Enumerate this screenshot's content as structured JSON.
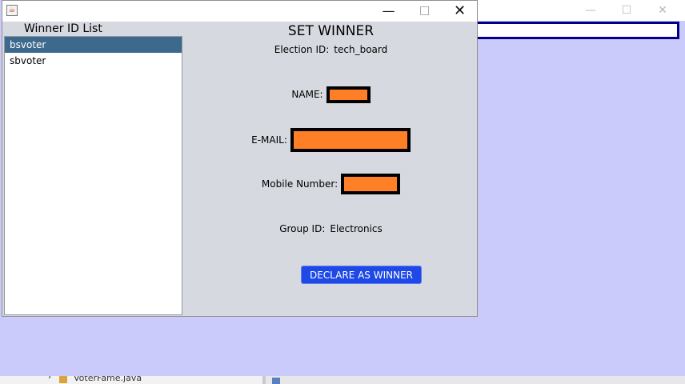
{
  "window": {
    "title": ""
  },
  "titlebar": {
    "minimize": "—",
    "maximize": "☐",
    "close": "✕"
  },
  "background_window": {
    "minimize": "—",
    "maximize": "☐",
    "close": "✕",
    "bottom_file_label": "VoterFame.java"
  },
  "winner_list": {
    "heading": "Winner ID List",
    "items": [
      "bsvoter",
      "sbvoter"
    ],
    "selected": "bsvoter"
  },
  "form": {
    "title": "SET WINNER",
    "election_label": "Election ID:",
    "election_value": "tech_board",
    "name_label": "NAME:",
    "email_label": "E-MAIL:",
    "mobile_label": "Mobile Number:",
    "group_label": "Group ID:",
    "group_value": "Electronics"
  },
  "actions": {
    "declare_label": "DECLARE AS WINNER"
  },
  "colors": {
    "dialog_bg": "#d6d9df",
    "background_window": "#cbcbfb",
    "selection": "#3d6a8c",
    "redaction": "#ff7f27",
    "button": "#1f49e6"
  }
}
